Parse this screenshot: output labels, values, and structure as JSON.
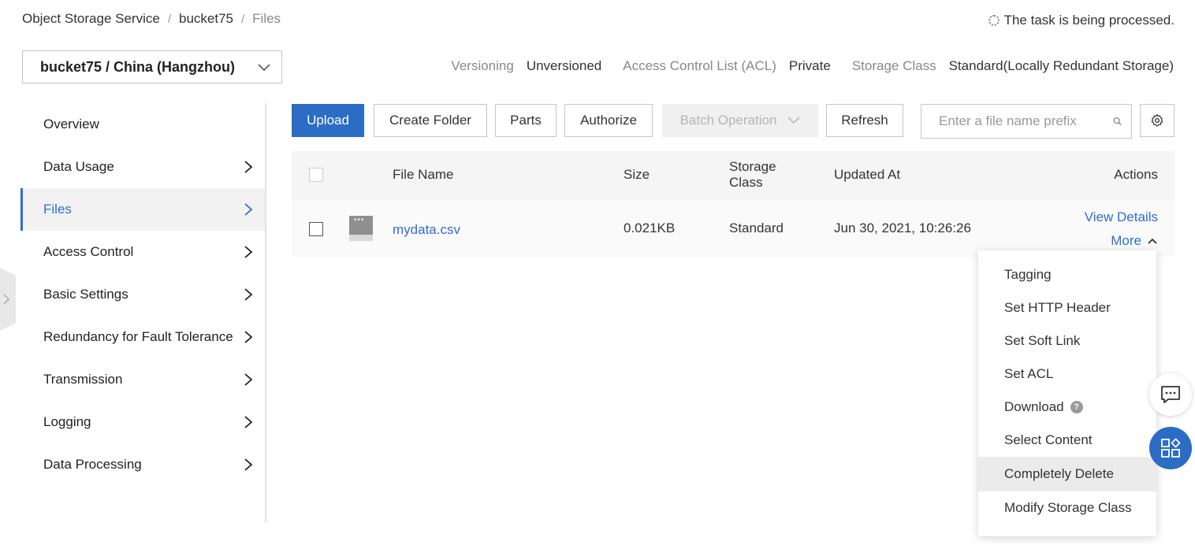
{
  "breadcrumb": {
    "items": [
      "Object Storage Service",
      "bucket75"
    ],
    "current": "Files"
  },
  "task_status": "The task is being processed.",
  "bucket_selector": {
    "value": "bucket75 / China (Hangzhou)"
  },
  "bucket_meta": {
    "versioning_label": "Versioning",
    "versioning_value": "Unversioned",
    "acl_label": "Access Control List (ACL)",
    "acl_value": "Private",
    "storage_label": "Storage Class",
    "storage_value": "Standard(Locally Redundant Storage)"
  },
  "sidebar": {
    "items": [
      {
        "label": "Overview"
      },
      {
        "label": "Data Usage"
      },
      {
        "label": "Files"
      },
      {
        "label": "Access Control"
      },
      {
        "label": "Basic Settings"
      },
      {
        "label": "Redundancy for Fault Tolerance"
      },
      {
        "label": "Transmission"
      },
      {
        "label": "Logging"
      },
      {
        "label": "Data Processing"
      }
    ]
  },
  "toolbar": {
    "upload": "Upload",
    "create_folder": "Create Folder",
    "parts": "Parts",
    "authorize": "Authorize",
    "batch_operation": "Batch Operation",
    "refresh": "Refresh",
    "search_placeholder": "Enter a file name prefix"
  },
  "table": {
    "headers": {
      "file_name": "File Name",
      "size": "Size",
      "storage_class": "Storage Class",
      "updated_at": "Updated At",
      "actions": "Actions"
    },
    "rows": [
      {
        "file_name": "mydata.csv",
        "size": "0.021KB",
        "storage_class": "Standard",
        "updated_at": "Jun 30, 2021, 10:26:26",
        "view_details": "View Details",
        "more": "More"
      }
    ]
  },
  "more_menu": {
    "items": [
      "Tagging",
      "Set HTTP Header",
      "Set Soft Link",
      "Set ACL",
      "Download",
      "Select Content",
      "Completely Delete",
      "Modify Storage Class"
    ],
    "highlighted": "Completely Delete"
  },
  "colors": {
    "accent": "#2b6cc4",
    "link": "#2e6fd1"
  }
}
